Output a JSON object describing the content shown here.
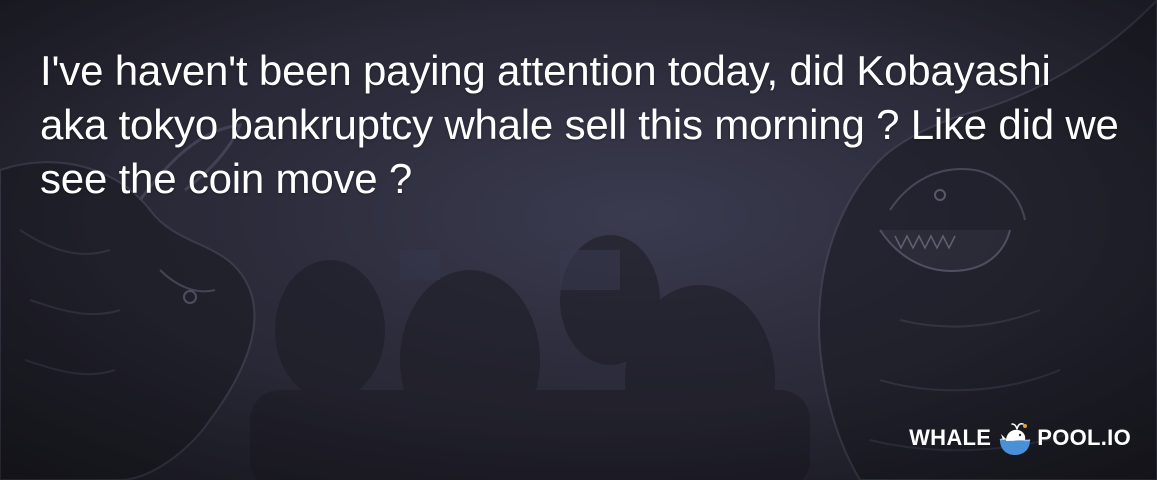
{
  "post": {
    "text": "I've haven't been paying attention today, did Kobayashi aka tokyo bankruptcy whale sell this morning ? Like did we see the coin move ?"
  },
  "brand": {
    "left": "WHALE",
    "right": "POOL.IO",
    "icon": "whale-icon"
  },
  "background": {
    "description_icons": [
      "bull-illustration",
      "bear-illustration",
      "trading-floor-crowd"
    ]
  },
  "colors": {
    "text": "#ffffff",
    "background": "#2b2b3a",
    "whale": "#4a90d9"
  }
}
